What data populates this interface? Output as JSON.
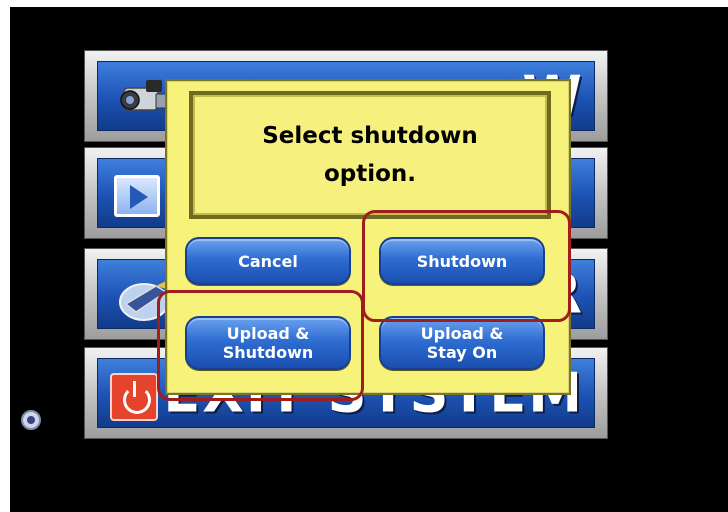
{
  "menu": {
    "video_label": "W",
    "play_label": "",
    "third_label": "R",
    "exit_label": "EXIT SYSTEM"
  },
  "dialog": {
    "message": "Select shutdown option.",
    "cancel_label": "Cancel",
    "shutdown_label": "Shutdown",
    "upload_shutdown_label": "Upload & Shutdown",
    "upload_stay_label": "Upload & Stay On"
  },
  "icons": {
    "video_icon": "video-camera-icon",
    "play_icon": "play-icon",
    "tool_icon": "tool-icon",
    "power_icon": "power-icon",
    "gear_icon": "gear-icon"
  },
  "colors": {
    "dialog_background": "#f7f27a",
    "button_blue": "#2f6dd2",
    "highlight_red": "#a01d1d",
    "exit_icon_red": "#e5432b"
  }
}
